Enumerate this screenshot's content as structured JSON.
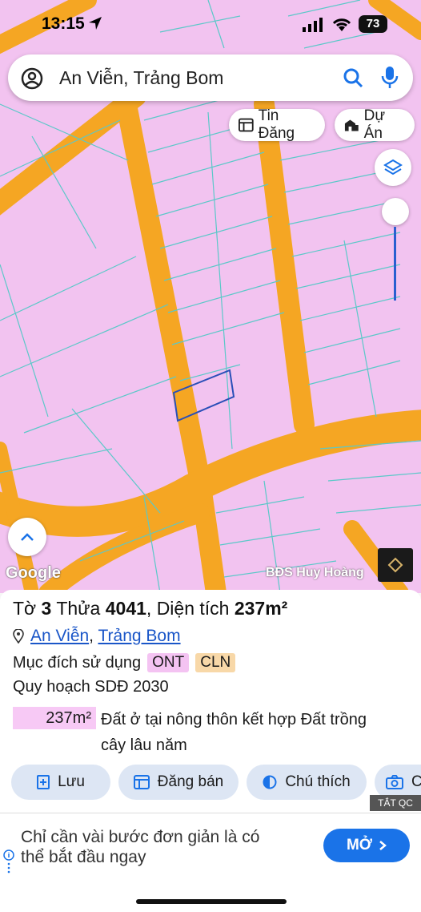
{
  "status_bar": {
    "time": "13:15",
    "battery": "73"
  },
  "search": {
    "query": "An Viễn, Trảng Bom"
  },
  "map_chips": {
    "listings": "Tin Đăng",
    "projects": "Dự Án"
  },
  "map_footer": {
    "google": "Google",
    "credit": "BĐS Huy Hoàng"
  },
  "parcel": {
    "sheet_label": "Tờ",
    "sheet": "3",
    "plot_label": "Thửa",
    "plot": "4041",
    "area_label": "Diện tích",
    "area": "237m²",
    "commune": "An Viễn",
    "district": "Trảng Bom",
    "purpose_label": "Mục đích sử dụng",
    "purpose_tags": [
      "ONT",
      "CLN"
    ],
    "plan_label": "Quy hoạch SDĐ 2030",
    "plan_area": "237m²",
    "plan_desc_line1": "Đất ở tại nông thôn kết hợp Đất trồng",
    "plan_desc_line2": "cây lâu năm"
  },
  "actions": {
    "save": "Lưu",
    "post": "Đăng bán",
    "note": "Chú thích",
    "photo": "C"
  },
  "ad": {
    "close": "TẮT QC",
    "text_line1": "Chỉ cần vài bước đơn giản là có",
    "text_line2": "thể bắt đầu ngay",
    "cta": "MỞ"
  },
  "colors": {
    "land": "#f2c3f0",
    "road": "#f5a623",
    "parcel_line": "#5bc8c8",
    "accent": "#1a73e8"
  }
}
